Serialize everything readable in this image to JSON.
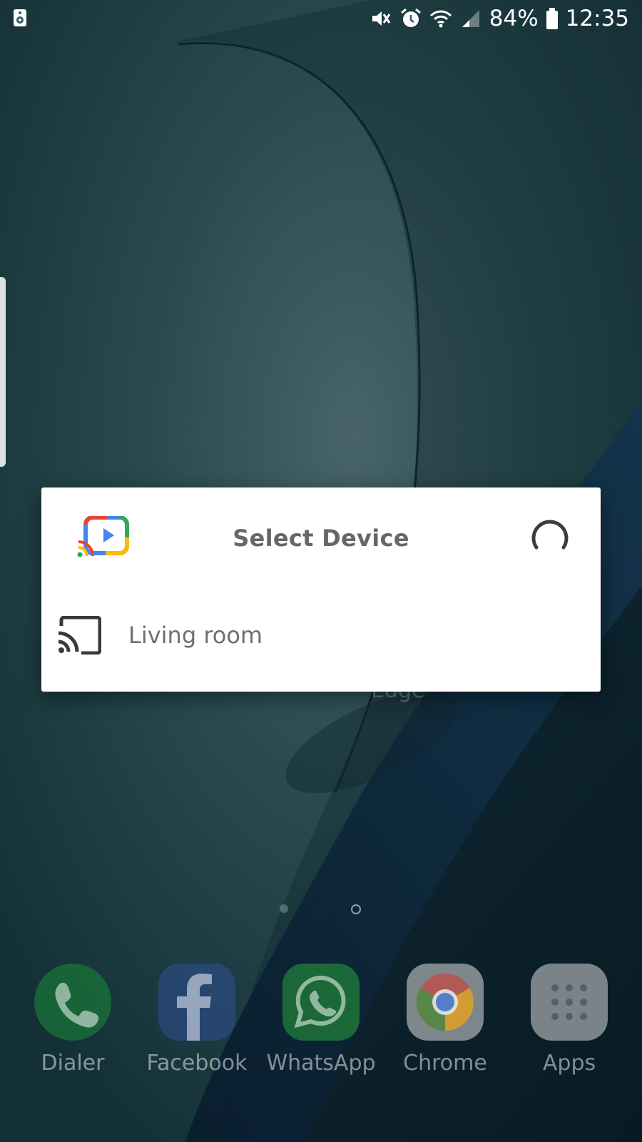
{
  "status_bar": {
    "battery_percent": "84%",
    "time": "12:35",
    "left_icon": "notification-app-icon",
    "right_icons": [
      "mute-icon",
      "alarm-icon",
      "wifi-icon",
      "signal-icon",
      "battery-icon"
    ]
  },
  "dialog": {
    "app_icon": "cast-video-app-icon",
    "title": "Select Device",
    "spinner_icon": "loading-spinner-icon",
    "devices": [
      {
        "label": "Living room",
        "icon": "cast-icon"
      }
    ]
  },
  "background": {
    "obscured_label": "Edge"
  },
  "page_indicator": {
    "pages": 3,
    "current_page": 3
  },
  "dock": {
    "apps": [
      {
        "label": "Dialer",
        "icon": "phone-icon",
        "color": "#1a9e3a"
      },
      {
        "label": "Facebook",
        "icon": "facebook-icon",
        "color": "#3b5ba0"
      },
      {
        "label": "WhatsApp",
        "icon": "whatsapp-icon",
        "color": "#2fb34a"
      },
      {
        "label": "Chrome",
        "icon": "chrome-icon",
        "color": "#e8e8e8"
      },
      {
        "label": "Apps",
        "icon": "apps-grid-icon",
        "color": "#d9d9d9"
      }
    ]
  }
}
